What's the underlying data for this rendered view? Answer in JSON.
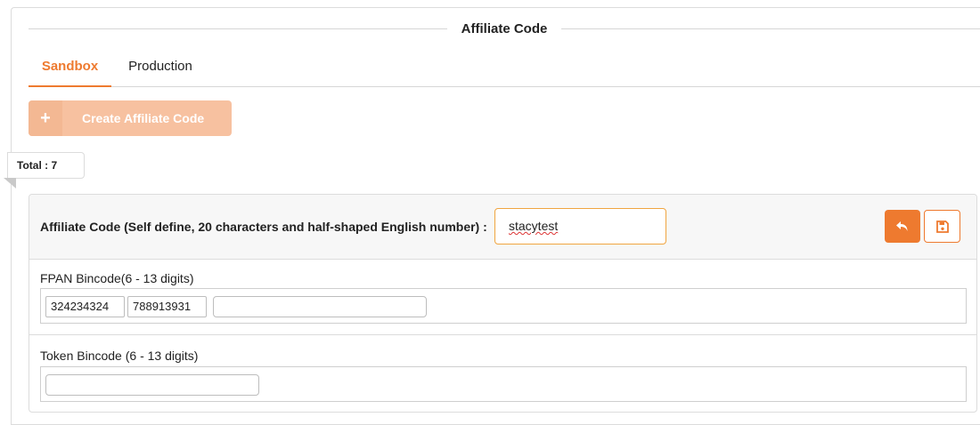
{
  "section_title": "Affiliate Code",
  "tabs": [
    {
      "label": "Sandbox",
      "active": true
    },
    {
      "label": "Production",
      "active": false
    }
  ],
  "create_button": {
    "icon": "+",
    "label": "Create Affiliate Code"
  },
  "total": "Total : 7",
  "card": {
    "code_label": "Affiliate Code (Self define, 20 characters and half-shaped English number) :",
    "code_value": "stacytest",
    "fpan": {
      "title": "FPAN Bincode(6 - 13 digits)",
      "chips": [
        "324234324",
        "788913931"
      ],
      "new_value": ""
    },
    "token": {
      "title": "Token Bincode (6 - 13 digits)",
      "new_value": ""
    }
  },
  "colors": {
    "accent": "#ee7a2f",
    "accent_disabled": "#f7c1a0",
    "input_focus": "#f0a540"
  },
  "icons": {
    "undo": "reply-arrow-icon",
    "save": "floppy-disk-icon",
    "create": "plus-icon"
  }
}
